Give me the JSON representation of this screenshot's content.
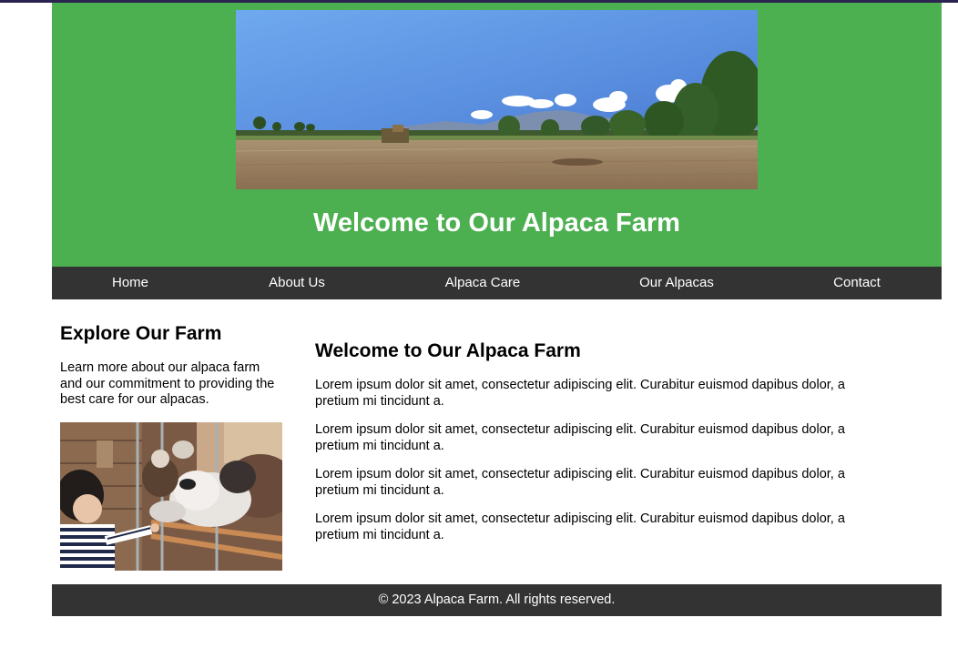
{
  "header": {
    "title": "Welcome to Our Alpaca Farm",
    "background_color": "#4caf50"
  },
  "nav": {
    "background_color": "#333333",
    "items": [
      {
        "label": "Home"
      },
      {
        "label": "About Us"
      },
      {
        "label": "Alpaca Care"
      },
      {
        "label": "Our Alpacas"
      },
      {
        "label": "Contact"
      }
    ]
  },
  "sidebar": {
    "heading": "Explore Our Farm",
    "text": "Learn more about our alpaca farm and our commitment to providing the best care for our alpacas."
  },
  "main": {
    "heading": "Welcome to Our Alpaca Farm",
    "paragraphs": [
      "Lorem ipsum dolor sit amet, consectetur adipiscing elit. Curabitur euismod dapibus dolor, a pretium mi tincidunt a.",
      "Lorem ipsum dolor sit amet, consectetur adipiscing elit. Curabitur euismod dapibus dolor, a pretium mi tincidunt a.",
      "Lorem ipsum dolor sit amet, consectetur adipiscing elit. Curabitur euismod dapibus dolor, a pretium mi tincidunt a.",
      "Lorem ipsum dolor sit amet, consectetur adipiscing elit. Curabitur euismod dapibus dolor, a pretium mi tincidunt a."
    ]
  },
  "footer": {
    "text": "© 2023 Alpaca Farm. All rights reserved."
  }
}
